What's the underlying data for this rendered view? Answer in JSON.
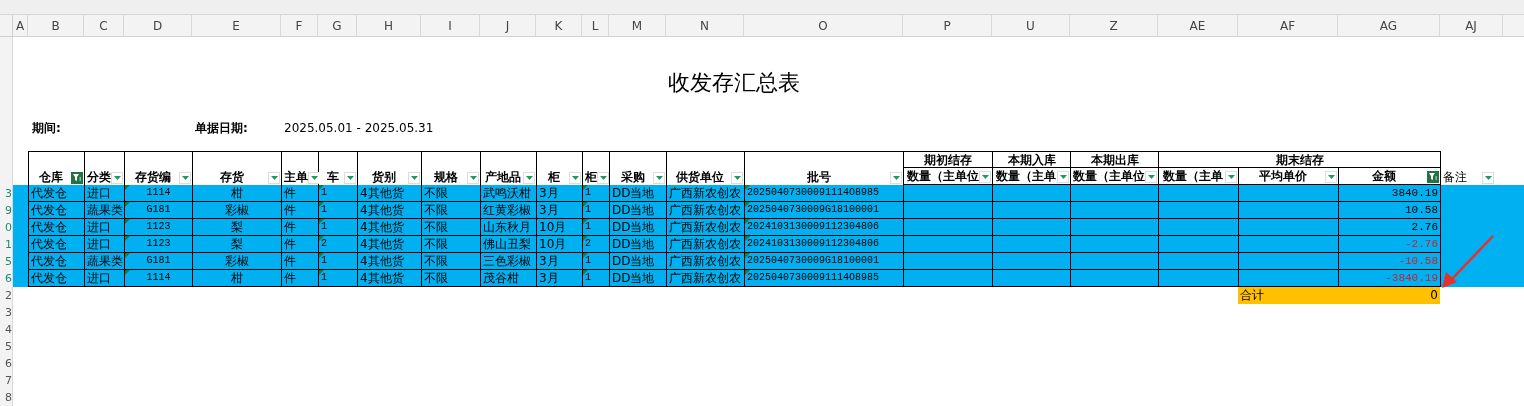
{
  "column_letters": [
    "A",
    "B",
    "C",
    "D",
    "E",
    "F",
    "G",
    "H",
    "I",
    "J",
    "K",
    "L",
    "M",
    "N",
    "O",
    "P",
    "U",
    "Z",
    "AE",
    "AF",
    "AG",
    "AJ"
  ],
  "title": "收发存汇总表",
  "period_label": "期间:",
  "date_label": "单据日期:",
  "date_range": "2025.05.01 - 2025.05.31",
  "header_groups": [
    {
      "columns": [
        {
          "label": "仓库",
          "filtered": true
        },
        {
          "label": "分类",
          "filtered": false
        },
        {
          "label": "存货编",
          "filtered": false
        },
        {
          "label": "存货",
          "filtered": false
        },
        {
          "label": "主单",
          "filtered": false
        },
        {
          "label": "车",
          "filtered": false
        },
        {
          "label": "货别",
          "filtered": false
        },
        {
          "label": "规格",
          "filtered": false
        },
        {
          "label": "产地品",
          "filtered": false
        },
        {
          "label": "柜",
          "filtered": false
        },
        {
          "label": "柜",
          "filtered": false
        },
        {
          "label": "采购",
          "filtered": false
        },
        {
          "label": "供货单位",
          "filtered": false
        },
        {
          "label": "批号",
          "filtered": false
        }
      ]
    },
    {
      "label": "期初结存",
      "columns": [
        {
          "label": "数量（主单位",
          "filtered": false
        }
      ]
    },
    {
      "label": "本期入库",
      "columns": [
        {
          "label": "数量（主单",
          "filtered": false
        }
      ]
    },
    {
      "label": "本期出库",
      "columns": [
        {
          "label": "数量（主单位",
          "filtered": false
        }
      ]
    },
    {
      "label": "期末结存",
      "columns": [
        {
          "label": "数量（主单",
          "filtered": false
        },
        {
          "label": "平均单价",
          "filtered": false
        },
        {
          "label": "金额",
          "filtered": true
        }
      ]
    }
  ],
  "remark_column": {
    "label": "备注",
    "filtered": false
  },
  "rows": [
    {
      "row_number": "3",
      "highlighted": true,
      "negative": false,
      "cells": [
        "代发仓",
        "进口",
        "1114",
        "柑",
        "件",
        "1",
        "4其他货",
        "不限",
        "武鸣沃柑",
        "3月",
        "1",
        "DD当地",
        "广西新农创农",
        "20250407300091114O8985"
      ],
      "amount": "3840.19"
    },
    {
      "row_number": "9",
      "highlighted": true,
      "negative": false,
      "cells": [
        "代发仓",
        "蔬果类",
        "G181",
        "彩椒",
        "件",
        "1",
        "4其他货",
        "不限",
        "红黄彩椒",
        "3月",
        "1",
        "DD当地",
        "广西新农创农",
        "2025040730009G18100001"
      ],
      "amount": "10.58"
    },
    {
      "row_number": "0",
      "highlighted": true,
      "negative": false,
      "cells": [
        "代发仓",
        "进口",
        "1123",
        "梨",
        "件",
        "1",
        "4其他货",
        "不限",
        "山东秋月",
        "10月",
        "1",
        "DD当地",
        "广西新农创农",
        "2024103130009112304806"
      ],
      "amount": "2.76"
    },
    {
      "row_number": "1",
      "highlighted": true,
      "negative": true,
      "cells": [
        "代发仓",
        "进口",
        "1123",
        "梨",
        "件",
        "2",
        "4其他货",
        "不限",
        "佛山丑梨",
        "10月",
        "2",
        "DD当地",
        "广西新农创农",
        "2024103130009112304806"
      ],
      "amount": "-2.76"
    },
    {
      "row_number": "5",
      "highlighted": true,
      "negative": true,
      "cells": [
        "代发仓",
        "蔬果类",
        "G181",
        "彩椒",
        "件",
        "1",
        "4其他货",
        "不限",
        "三色彩椒",
        "3月",
        "1",
        "DD当地",
        "广西新农创农",
        "2025040730009G18100001"
      ],
      "amount": "-10.58"
    },
    {
      "row_number": "6",
      "highlighted": true,
      "negative": true,
      "cells": [
        "代发仓",
        "进口",
        "1114",
        "柑",
        "件",
        "1",
        "4其他货",
        "不限",
        "茂谷柑",
        "3月",
        "1",
        "DD当地",
        "广西新农创农",
        "20250407300091114O8985"
      ],
      "amount": "-3840.19"
    }
  ],
  "total": {
    "row_number": "2",
    "label": "合计",
    "value": "0"
  },
  "empty_row_numbers": [
    "3",
    "4",
    "5",
    "6",
    "7",
    "8"
  ]
}
